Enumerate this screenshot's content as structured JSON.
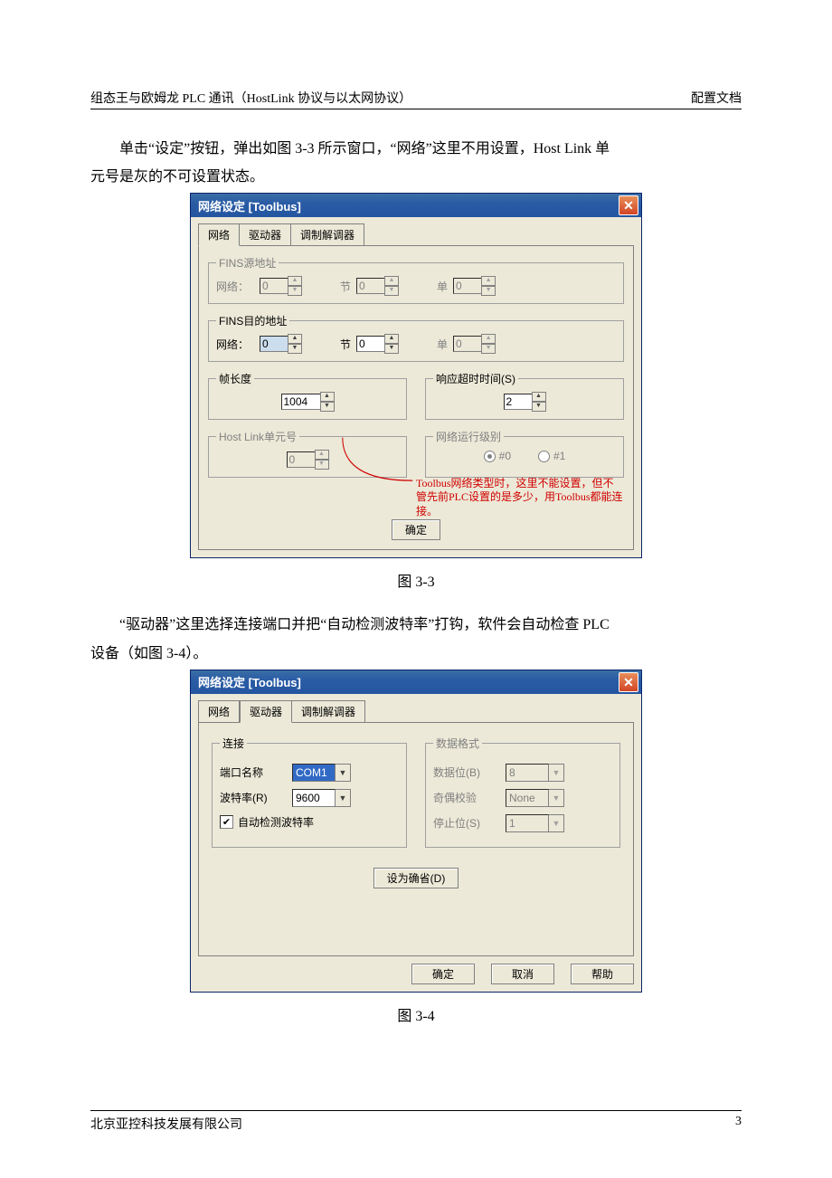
{
  "header": {
    "left": "组态王与欧姆龙 PLC 通讯（HostLink 协议与以太网协议）",
    "right": "配置文档"
  },
  "para1a": "单击“设定”按钮，弹出如图 3-3 所示窗口，“网络”这里不用设置，Host Link 单",
  "para1b": "元号是灰的不可设置状态。",
  "caption1": "图 3-3",
  "para2a": "“驱动器”这里选择连接端口并把“自动检测波特率”打钩，软件会自动检查 PLC",
  "para2b": "设备（如图 3-4）。",
  "caption2": "图 3-4",
  "footer": {
    "left": "北京亚控科技发展有限公司",
    "right": "3"
  },
  "dlg1": {
    "title": "网络设定 [Toolbus]",
    "tabs": [
      "网络",
      "驱动器",
      "调制解调器"
    ],
    "src": {
      "legend": "FINS源地址",
      "net_lbl": "网络：",
      "net_v": "0",
      "node_lbl": "节",
      "node_v": "0",
      "unit_lbl": "单",
      "unit_v": "0"
    },
    "dst": {
      "legend": "FINS目的地址",
      "net_lbl": "网络：",
      "net_v": "0",
      "node_lbl": "节",
      "node_v": "0",
      "unit_lbl": "单",
      "unit_v": "0"
    },
    "frame": {
      "legend": "帧长度",
      "v": "1004"
    },
    "timeout": {
      "legend": "响应超时时间(S)",
      "v": "2"
    },
    "hostlink": {
      "legend": "Host Link单元号",
      "v": "0"
    },
    "level": {
      "legend": "网络运行级别",
      "opt0": "#0",
      "opt1": "#1"
    },
    "annot": "Toolbus网络类型时，这里不能设置，但不管先前PLC设置的是多少，用Toolbus都能连接。",
    "ok": "确定"
  },
  "dlg2": {
    "title": "网络设定 [Toolbus]",
    "tabs": [
      "网络",
      "驱动器",
      "调制解调器"
    ],
    "conn": {
      "legend": "连接",
      "port_lbl": "端口名称",
      "port_v": "COM1",
      "baud_lbl": "波特率(R)",
      "baud_v": "9600",
      "auto": "自动检测波特率"
    },
    "fmt": {
      "legend": "数据格式",
      "data_lbl": "数据位(B)",
      "data_v": "8",
      "par_lbl": "奇偶校验",
      "par_v": "None",
      "stop_lbl": "停止位(S)",
      "stop_v": "1"
    },
    "default_btn": "设为确省(D)",
    "ok": "确定",
    "cancel": "取消",
    "help": "帮助"
  }
}
